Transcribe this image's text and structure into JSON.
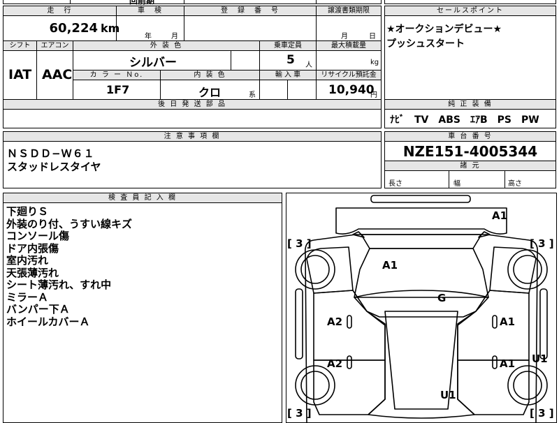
{
  "top_box_partial": {
    "text": "回前期"
  },
  "mileage": {
    "header": "走　行",
    "value": "60,224",
    "unit": "km"
  },
  "inspection": {
    "header": "車　検",
    "year_unit": "年",
    "month_unit": "月"
  },
  "registration": {
    "header": "登　録　番　号"
  },
  "transfer": {
    "header": "譲渡書類期限",
    "month_unit": "月",
    "day_unit": "日"
  },
  "row2": {
    "shift_label": "シフト",
    "shift_value": "IAT",
    "aircon_label": "エアコン",
    "aircon_value": "AAC",
    "exterior_color_label": "外 装 色",
    "exterior_color_value": "シルバー",
    "capacity_label": "乗車定員",
    "capacity_value": "5",
    "capacity_unit": "人",
    "max_load_label": "最大積載量",
    "max_load_unit": "kg",
    "color_no_label": "カ ラ ー Ｎo.",
    "color_no_value": "1F7",
    "interior_color_label": "内 装 色",
    "interior_color_value": "クロ",
    "interior_color_suffix": "系",
    "import_label": "輸 入 車",
    "recycle_label": "リサイクル預託金",
    "recycle_value": "10,940",
    "recycle_unit": "円"
  },
  "later_parts": {
    "header": "後 日 発 送 部 品"
  },
  "selling_points": {
    "header": "セールスポイント",
    "lines": [
      "★オークションデビュー★",
      "プッシュスタート"
    ]
  },
  "equipment": {
    "header": "純 正 装 備",
    "value": "ﾅﾋﾞ　TV　ABS　ｴｱB　PS　PW"
  },
  "notes": {
    "header": "注 意 事 項 欄",
    "lines": [
      "ＮＳＤＤ−Ｗ６１",
      "スタッドレスタイヤ"
    ]
  },
  "chassis": {
    "header": "車 台 番 号",
    "value": "NZE151-4005344"
  },
  "specs": {
    "header": "諸 元",
    "length_label": "長さ",
    "width_label": "幅",
    "height_label": "高さ"
  },
  "inspector": {
    "header": "検 査 員 記 入 欄",
    "lines": [
      "下廻りＳ",
      "外装のり付、うすい線キズ",
      "コンソール傷",
      "ドア内張傷",
      "室内汚れ",
      "天張薄汚れ",
      "シート薄汚れ、すれ中",
      "ミラーＡ",
      "バンパー下Ａ",
      "ホイールカバーＡ"
    ]
  },
  "damage_map": {
    "marks": {
      "bumper_front": "A1",
      "hood": "A1",
      "roof": "G",
      "left_front_door": "A2",
      "left_rear_door": "A2",
      "right_front_door": "A1",
      "right_rear_door": "A1",
      "right_rear_fender": "U1",
      "trunk": "U1"
    },
    "wheel_fl": "[ 3 ]",
    "wheel_fr": "[ 3 ]",
    "wheel_rl": "[ 3 ]",
    "wheel_rr": "[ 3 ]"
  }
}
